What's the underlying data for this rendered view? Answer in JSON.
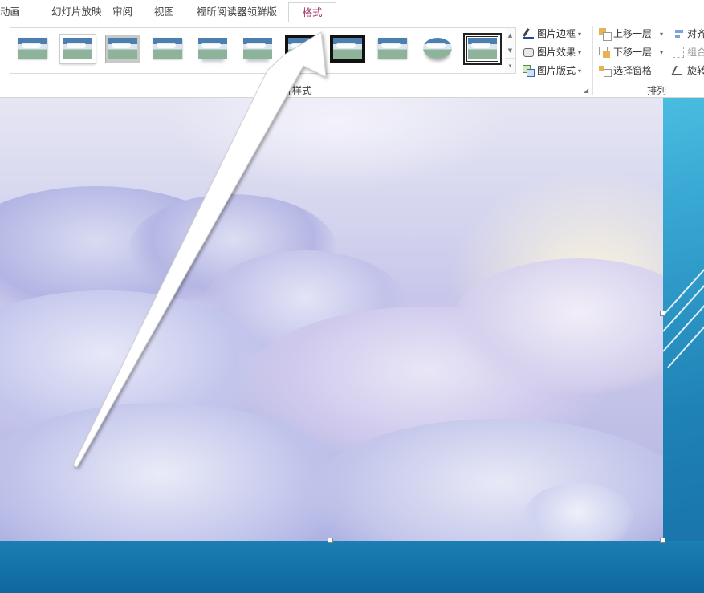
{
  "tabs": [
    {
      "label": "动画",
      "active": false
    },
    {
      "label": "幻灯片放映",
      "active": false
    },
    {
      "label": "审阅",
      "active": false
    },
    {
      "label": "视图",
      "active": false
    },
    {
      "label": "福昕阅读器领鲜版",
      "active": false
    },
    {
      "label": "格式",
      "active": true
    }
  ],
  "ribbon": {
    "picture_styles": {
      "group_label": "图片样式",
      "gallery_styles": [
        "simple-frame",
        "soft-edge-frame",
        "gray-matte",
        "drop-shadow",
        "reflected",
        "soft-reflected",
        "black-frame-partial",
        "thick-black-frame",
        "beveled",
        "oval-reflected",
        "double-frame"
      ],
      "buttons": {
        "border": "图片边框",
        "effects": "图片效果",
        "layout": "图片版式"
      }
    },
    "arrange": {
      "group_label": "排列",
      "buttons": {
        "bring_forward": "上移一层",
        "send_backward": "下移一层",
        "selection_pane": "选择窗格",
        "align": "对齐",
        "group": "组合",
        "rotate": "旋转"
      }
    }
  },
  "colors": {
    "active_tab_text": "#a1356b",
    "slide_background": "#1f82b6",
    "arrow": "#ffffff"
  },
  "icons": [
    "picture-border-icon",
    "picture-effects-icon",
    "picture-layout-icon",
    "bring-forward-icon",
    "send-backward-icon",
    "selection-pane-icon",
    "align-icon",
    "group-icon",
    "rotate-icon",
    "gallery-scroll-up-icon",
    "gallery-scroll-down-icon",
    "gallery-more-icon",
    "dialog-launcher-icon"
  ]
}
